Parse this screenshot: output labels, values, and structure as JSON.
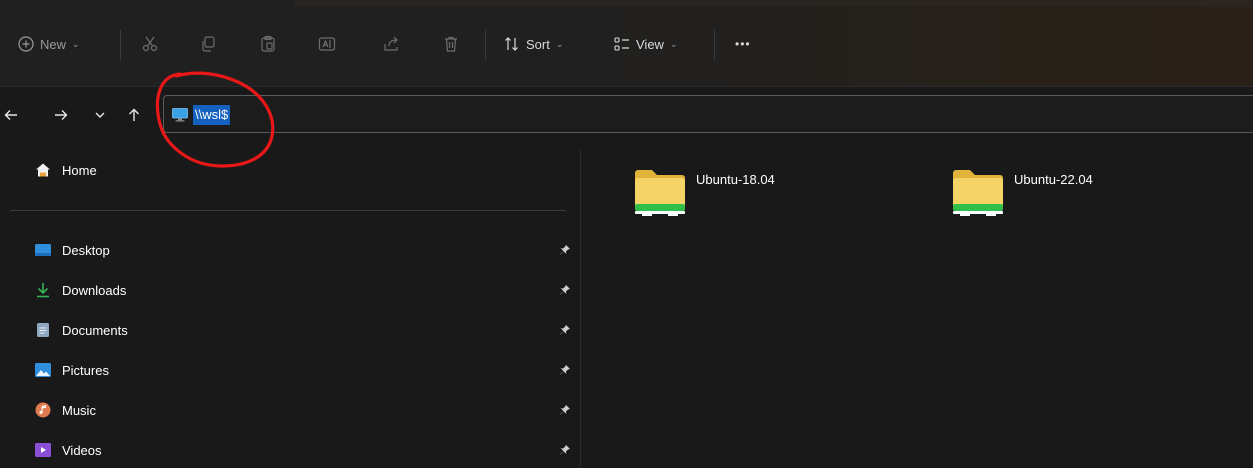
{
  "toolbar": {
    "new_label": "New",
    "sort_label": "Sort",
    "view_label": "View",
    "more_label": "•••",
    "icons": [
      "plus-circle-icon",
      "cut-icon",
      "copy-icon",
      "paste-icon",
      "rename-icon",
      "share-icon",
      "delete-icon",
      "sort-icon",
      "view-icon"
    ]
  },
  "address": {
    "path": "\\\\wsl$",
    "annotation_color": "#e81818"
  },
  "sidebar": {
    "home_label": "Home",
    "items": [
      {
        "label": "Desktop",
        "icon": "desktop-icon"
      },
      {
        "label": "Downloads",
        "icon": "downloads-icon"
      },
      {
        "label": "Documents",
        "icon": "documents-icon"
      },
      {
        "label": "Pictures",
        "icon": "pictures-icon"
      },
      {
        "label": "Music",
        "icon": "music-icon"
      },
      {
        "label": "Videos",
        "icon": "videos-icon"
      }
    ]
  },
  "content": {
    "folders": [
      {
        "name": "Ubuntu-18.04"
      },
      {
        "name": "Ubuntu-22.04"
      }
    ]
  },
  "colors": {
    "background": "#191919",
    "selection": "#1561c0",
    "folder_yellow": "#f4d466",
    "drive_green": "#2fbf4a"
  }
}
